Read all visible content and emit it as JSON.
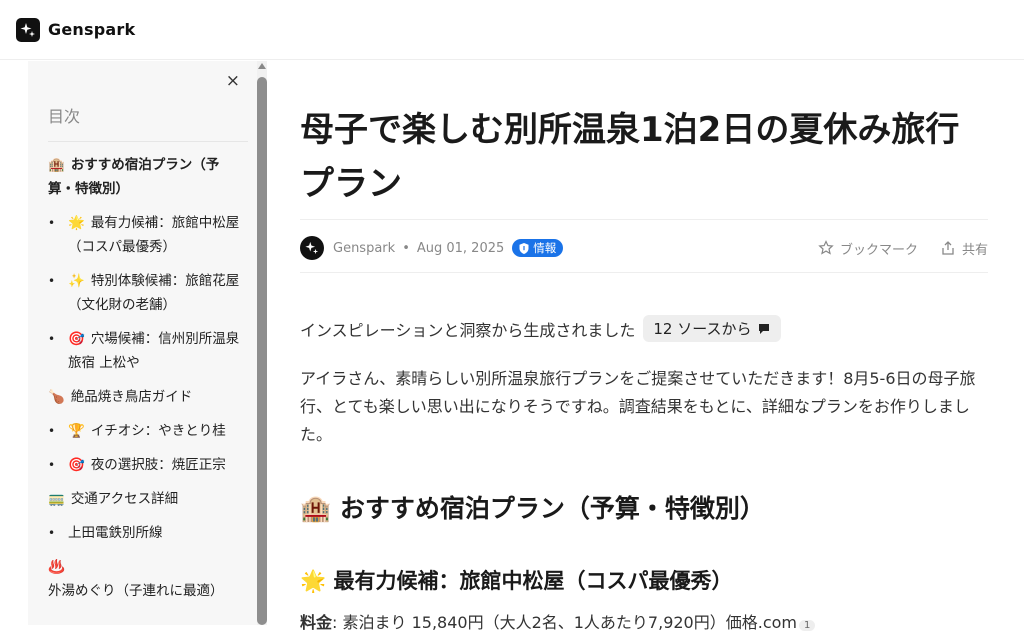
{
  "brand": {
    "name": "Genspark"
  },
  "toc": {
    "close": "×",
    "title": "目次",
    "items": [
      {
        "emoji": "🏨",
        "label": "おすすめ宿泊プラン（予算・特徴別）"
      },
      {
        "bullet": "•",
        "emoji": "🌟",
        "label": "最有力候補：旅館中松屋（コスパ最優秀）"
      },
      {
        "bullet": "•",
        "emoji": "✨",
        "label": "特別体験候補：旅館花屋（文化財の老舗）"
      },
      {
        "bullet": "•",
        "emoji": "🎯",
        "label": "穴場候補：信州別所温泉 旅宿 上松や"
      },
      {
        "emoji": "🍗",
        "label": "絶品焼き鳥店ガイド"
      },
      {
        "bullet": "•",
        "emoji": "🏆",
        "label": "イチオシ：やきとり桂"
      },
      {
        "bullet": "•",
        "emoji": "🎯",
        "label": "夜の選択肢：焼匠正宗"
      },
      {
        "emoji": "🚃",
        "label": "交通アクセス詳細"
      },
      {
        "bullet": "•",
        "emoji": "",
        "label": "上田電鉄別所線"
      },
      {
        "emoji": "♨️",
        "label": "外湯めぐり（子連れに最適）"
      }
    ]
  },
  "article": {
    "title": "母子で楽しむ別所温泉1泊2日の夏休み旅行プラン",
    "author": "Genspark",
    "separator": "•",
    "date": "Aug 01, 2025",
    "badge": "情報",
    "bookmark": "ブックマーク",
    "share": "共有",
    "inspiration": "インスピレーションと洞察から生成されました",
    "sources": "12 ソースから",
    "intro": "アイラさん、素晴らしい別所温泉旅行プランをご提案させていただきます！8月5-6日の母子旅行、とても楽しい思い出になりそうですね。調査結果をもとに、詳細なプランをお作りしました。",
    "section_emoji": "🏨",
    "section_title": "おすすめ宿泊プラン（予算・特徴別）",
    "sub_emoji": "🌟",
    "sub_title": "最有力候補：旅館中松屋（コスパ最優秀）",
    "price_label": "料金",
    "price_text": ": 素泊まり 15,840円（大人2名、1人あたり7,920円）価格.com",
    "price_cite": "1"
  },
  "icons": {
    "logo": "sparkle-icon",
    "close": "close-icon",
    "bookmark": "star-outline-icon",
    "share": "share-icon",
    "badge": "shield-icon",
    "sources": "chat-bubble-icon"
  },
  "colors": {
    "accent": "#1a73e8",
    "sidebar_bg": "#f7f7f7"
  }
}
